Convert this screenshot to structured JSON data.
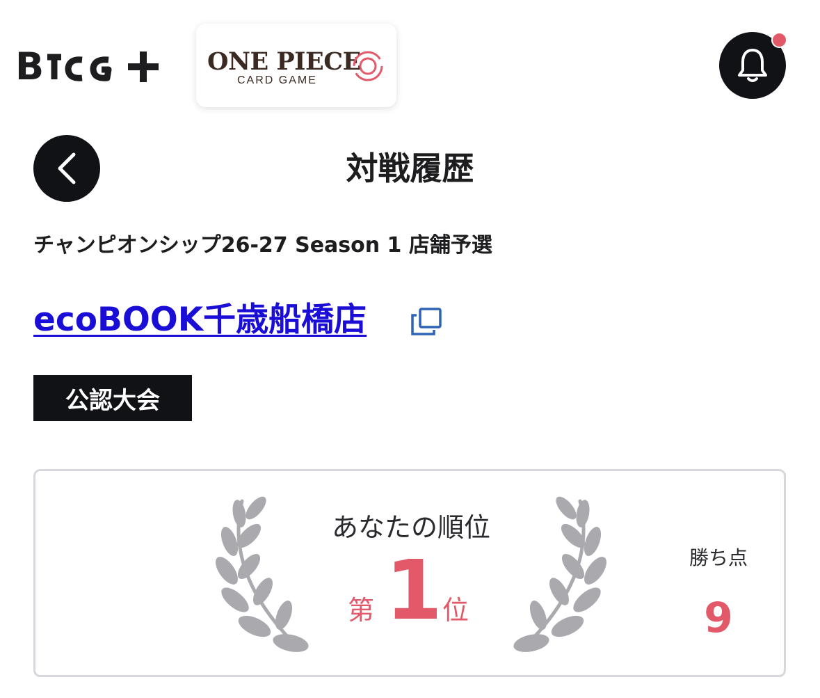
{
  "header": {
    "brand_logo_text": "B TCG+",
    "game_logo": {
      "title": "ONE PIECE",
      "subtitle": "CARD GAME"
    },
    "notification_icon": "bell-icon",
    "notification_dot_color": "#e2596a"
  },
  "page": {
    "back_icon": "chevron-left-icon",
    "title": "対戦履歴"
  },
  "event": {
    "name": "チャンピオンシップ26-27 Season 1 店舗予選",
    "store_name": "ecoBOOK千歳船橋店",
    "external_link_icon": "external-link-icon",
    "badge": "公認大会"
  },
  "result": {
    "rank_label": "あなたの順位",
    "rank_prefix": "第",
    "rank_value": "1",
    "rank_suffix": "位",
    "points_label": "勝ち点",
    "points_value": "9",
    "accent_color": "#e2596a",
    "decoration_icon": "laurel-wreath-icon"
  }
}
